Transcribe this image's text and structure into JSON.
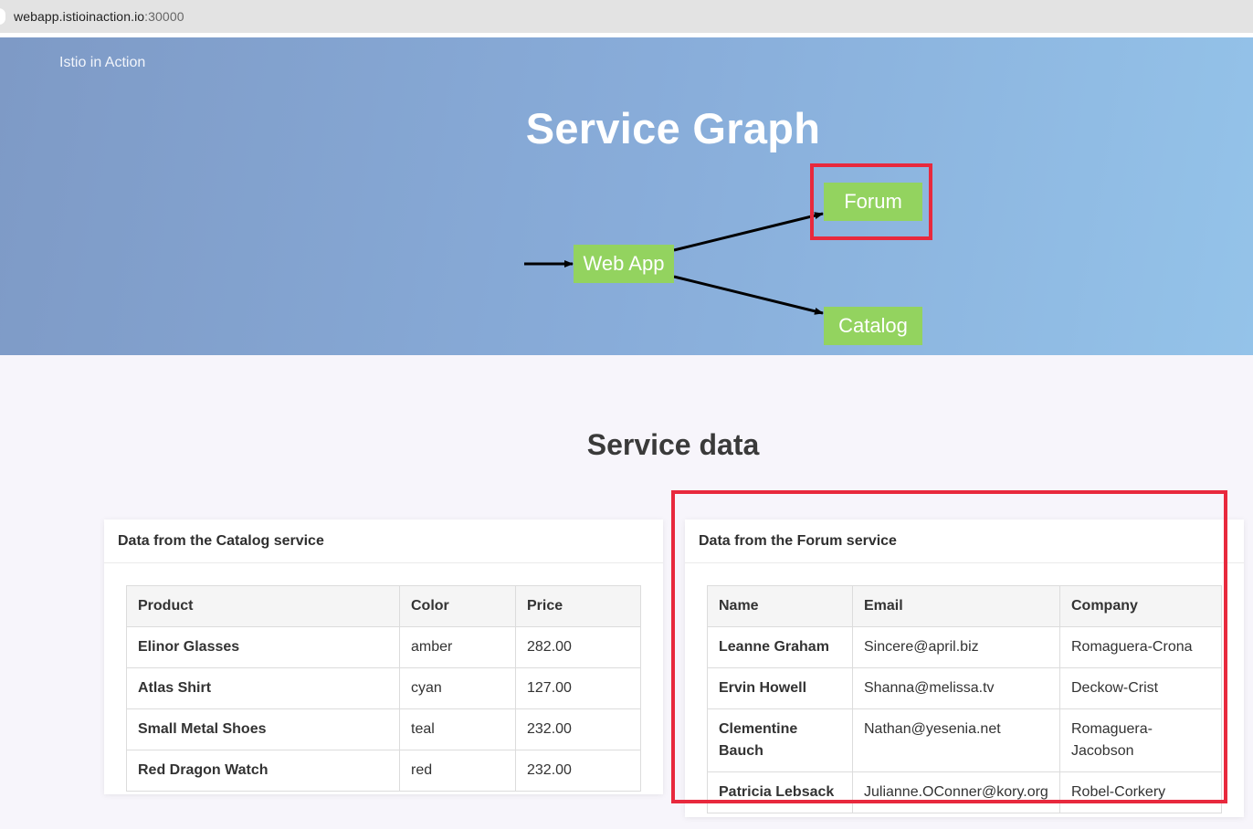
{
  "browser": {
    "url_host": "webapp.istioinaction.io",
    "url_port": ":30000"
  },
  "header": {
    "brand": "Istio in Action",
    "title": "Service Graph"
  },
  "graph": {
    "nodes": {
      "webapp": "Web App",
      "forum": "Forum",
      "catalog": "Catalog"
    }
  },
  "colors": {
    "node_fill": "#93d35f",
    "highlight": "#e8293d",
    "hero_start": "#7e9ac6",
    "hero_end": "#94c3e9"
  },
  "service_data": {
    "title": "Service data",
    "catalog": {
      "heading": "Data from the Catalog service",
      "columns": [
        "Product",
        "Color",
        "Price"
      ],
      "rows": [
        [
          "Elinor Glasses",
          "amber",
          "282.00"
        ],
        [
          "Atlas Shirt",
          "cyan",
          "127.00"
        ],
        [
          "Small Metal Shoes",
          "teal",
          "232.00"
        ],
        [
          "Red Dragon Watch",
          "red",
          "232.00"
        ]
      ]
    },
    "forum": {
      "heading": "Data from the Forum service",
      "columns": [
        "Name",
        "Email",
        "Company"
      ],
      "rows": [
        [
          "Leanne Graham",
          "Sincere@april.biz",
          "Romaguera-Crona"
        ],
        [
          "Ervin Howell",
          "Shanna@melissa.tv",
          "Deckow-Crist"
        ],
        [
          "Clementine Bauch",
          "Nathan@yesenia.net",
          "Romaguera-Jacobson"
        ],
        [
          "Patricia Lebsack",
          "Julianne.OConner@kory.org",
          "Robel-Corkery"
        ]
      ]
    }
  }
}
